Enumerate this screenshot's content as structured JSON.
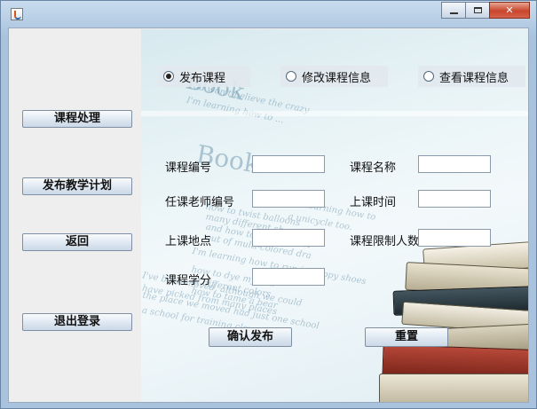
{
  "window": {
    "title": "",
    "controls": {
      "minimize_glyph": "",
      "maximize_glyph": "",
      "close_glyph": "✕"
    }
  },
  "sidebar": {
    "buttons": [
      {
        "label": "课程处理"
      },
      {
        "label": "发布教学计划"
      },
      {
        "label": "返回"
      },
      {
        "label": "退出登录"
      }
    ]
  },
  "mode_options": {
    "selected": "发布课程",
    "items": [
      {
        "label": "发布课程",
        "checked": true
      },
      {
        "label": "修改课程信息",
        "checked": false
      },
      {
        "label": "查看课程信息",
        "checked": false
      }
    ]
  },
  "form": {
    "course_id": {
      "label": "课程编号",
      "value": ""
    },
    "course_name": {
      "label": "课程名称",
      "value": ""
    },
    "teacher_id": {
      "label": "任课老师编号",
      "value": ""
    },
    "class_time": {
      "label": "上课时间",
      "value": ""
    },
    "location": {
      "label": "上课地点",
      "value": ""
    },
    "capacity": {
      "label": "课程限制人数",
      "value": ""
    },
    "credits": {
      "label": "课程学分",
      "value": ""
    }
  },
  "actions": {
    "confirm_label": "确认发布",
    "reset_label": "重置"
  },
  "background": {
    "watermark_title": "Book",
    "watermark_lines": [
      "You won't believe the crazy",
      "I'm learning how to ...",
      "learning how to",
      "a unicycle too.",
      "how to twist balloons",
      "many different shapes",
      "and how to make a cost",
      "out of multi-colored dra",
      "I'm learning how to",
      "I'm learning how to run in floppy shoes",
      "how to dye my hair",
      "of different colors",
      "how to tame a bear",
      "I've been moved, although we could",
      "have picked from many places",
      "the place we moved had just one school",
      "a school for training clowns."
    ]
  },
  "colors": {
    "accent": "#2a6ab0",
    "close": "#c9452b"
  }
}
